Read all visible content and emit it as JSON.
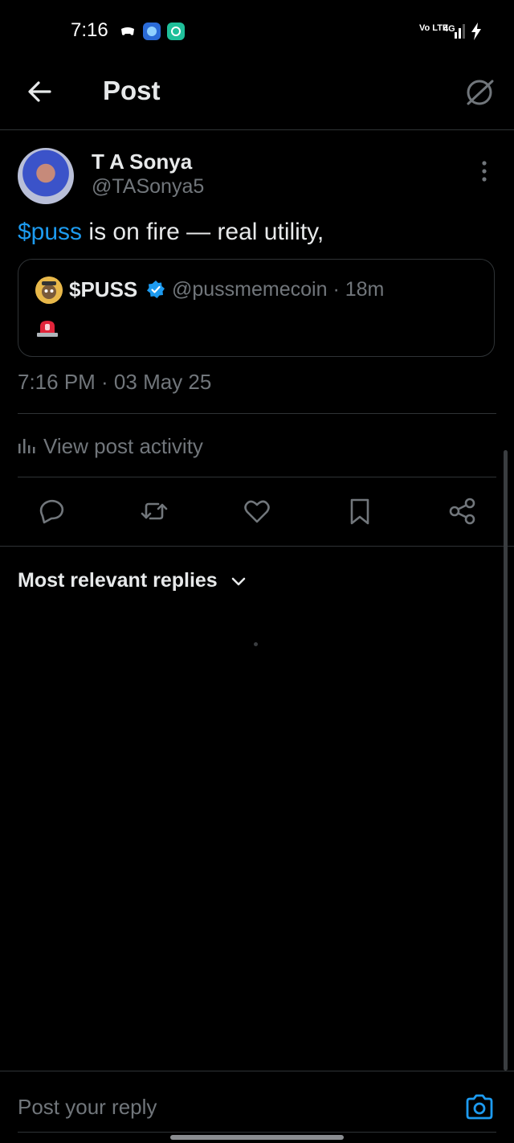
{
  "status_bar": {
    "time": "7:16",
    "network_label": "Vo LTE",
    "signal_label": "4G"
  },
  "header": {
    "title": "Post",
    "back_icon": "arrow-left-icon",
    "grok_icon": "grok-icon"
  },
  "post": {
    "author_name": "T A Sonya",
    "author_handle": "@TASonya5",
    "cashtag": "$puss",
    "text_rest": " is on fire — real utility,",
    "quote": {
      "name": "$PUSS",
      "handle_meta": "@pussmemecoin · 18m",
      "verified_color": "#1d9bf0",
      "content_icon": "police-light-emoji"
    },
    "timestamp": "7:16 PM · 03 May 25",
    "activity_label": "View post activity"
  },
  "actions": [
    "reply-icon",
    "repost-icon",
    "like-icon",
    "bookmark-icon",
    "share-icon"
  ],
  "replies": {
    "sort_label": "Most relevant replies"
  },
  "composer": {
    "placeholder": "Post your reply"
  },
  "colors": {
    "background": "#000000",
    "accent": "#1d9bf0",
    "text": "#e7e9ea",
    "muted": "#71767b",
    "divider": "#2f3336"
  }
}
